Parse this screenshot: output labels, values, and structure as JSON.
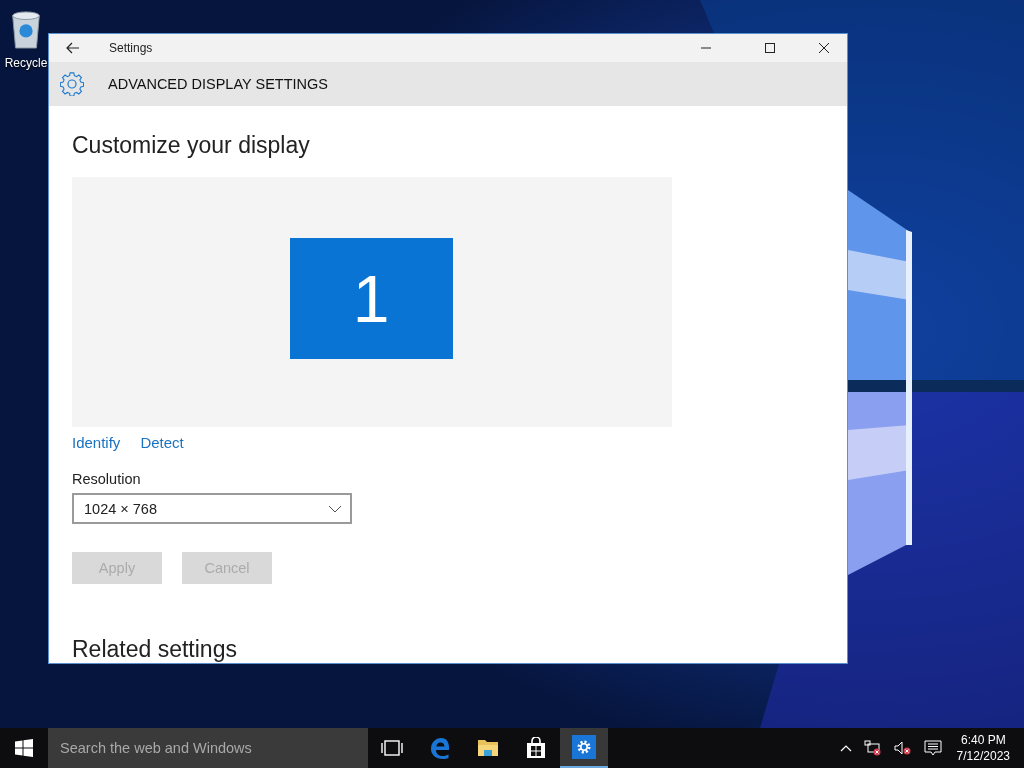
{
  "desktop": {
    "icons": [
      {
        "label": "Recycle"
      }
    ]
  },
  "window": {
    "title": "Settings",
    "header": "ADVANCED DISPLAY SETTINGS",
    "heading": "Customize your display",
    "displays": [
      {
        "label": "1",
        "selected": true
      }
    ],
    "links": [
      "Identify",
      "Detect"
    ],
    "resolution": {
      "label": "Resolution",
      "value": "1024 × 768"
    },
    "buttons": [
      {
        "label": "Apply",
        "disabled": true
      },
      {
        "label": "Cancel",
        "disabled": true
      }
    ],
    "section_heading": "Related settings"
  },
  "taskbar": {
    "search": {
      "placeholder": "Search the web and Windows"
    },
    "apps": [
      {
        "kind": "taskview",
        "active": false
      },
      {
        "kind": "edge",
        "active": false
      },
      {
        "kind": "explorer",
        "active": false
      },
      {
        "kind": "store",
        "active": false
      },
      {
        "kind": "settings",
        "active": true
      }
    ],
    "clock": {
      "time": "6:40 PM",
      "date": "7/12/2023"
    }
  }
}
